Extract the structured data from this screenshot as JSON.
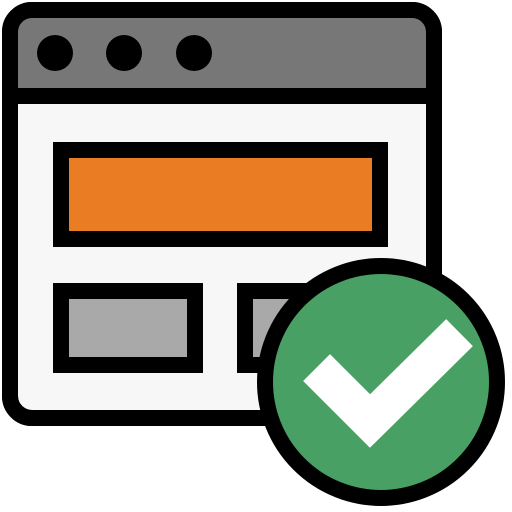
{
  "icon": {
    "name": "webpage-approved-icon",
    "colors": {
      "outline": "#000000",
      "titlebar": "#777777",
      "window_bg": "#f7f7f7",
      "banner": "#ea7d24",
      "blocks": "#a9a9a9",
      "badge": "#48a064",
      "check": "#ffffff"
    },
    "window_controls": [
      "dot",
      "dot",
      "dot"
    ],
    "badge": {
      "icon": "check-icon",
      "status": "approved"
    }
  }
}
